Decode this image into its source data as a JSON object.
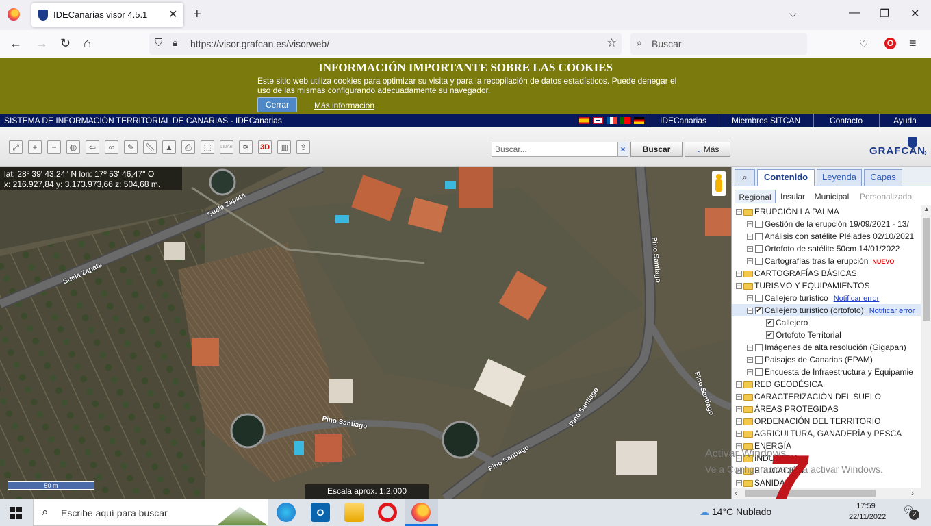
{
  "browser": {
    "tab_title": "IDECanarias visor 4.5.1",
    "url": "https://visor.grafcan.es/visorweb/",
    "search_placeholder": "Buscar"
  },
  "cookie_banner": {
    "title": "INFORMACIÓN IMPORTANTE SOBRE LAS COOKIES",
    "text": "Este sitio web utiliza cookies para optimizar su visita y para la recopilación de datos estadísticos. Puede denegar el uso de las mismas configurando adecuadamente su navegador.",
    "close_label": "Cerrar",
    "more_label": "Más información"
  },
  "site_header": {
    "title": "SISTEMA DE INFORMACIÓN TERRITORIAL DE CANARIAS - IDECanarias",
    "links": [
      "IDECanarias",
      "Miembros SITCAN",
      "Contacto",
      "Ayuda"
    ]
  },
  "toolbar": {
    "search_placeholder": "Buscar...",
    "search_clear": "×",
    "search_button": "Buscar",
    "more_button": "Más",
    "brand": "GRAFCAN",
    "brand_arrow": "»",
    "tools": [
      "full-extent",
      "zoom-in",
      "zoom-out",
      "globe",
      "back",
      "link",
      "draw",
      "measure",
      "profile",
      "print",
      "select",
      "lidar",
      "layers",
      "3D",
      "info",
      "share"
    ]
  },
  "map": {
    "coords_line1": "lat: 28º 39' 43,24'' N  lon: 17º 53' 46,47'' O",
    "coords_line2": "x: 216.927,84  y: 3.173.973,66  z: 504,68 m.",
    "scale_bar_label": "50 m",
    "scale_text": "Escala aprox. 1:2.000",
    "road_labels": [
      "Suela Zapata",
      "Suela Zapata",
      "Pino Santiago",
      "Pino Santiago",
      "Pino Santiago",
      "Pino Santiago",
      "Pino Santiago"
    ]
  },
  "panel": {
    "tabs": [
      "Contenido",
      "Leyenda",
      "Capas"
    ],
    "subtabs": [
      "Regional",
      "Insular",
      "Municipal",
      "Personalizado"
    ],
    "tree": [
      {
        "label": "ERUPCIÓN LA PALMA",
        "type": "folder",
        "level": 0,
        "exp": "−"
      },
      {
        "label": "Gestión de la erupción 19/09/2021 - 13/",
        "type": "layer",
        "level": 1,
        "exp": "+",
        "checked": false
      },
      {
        "label": "Análisis con satélite Pléiades 02/10/2021",
        "type": "layer",
        "level": 1,
        "exp": "+",
        "checked": false
      },
      {
        "label": "Ortofoto de satélite 50cm 14/01/2022",
        "type": "layer",
        "level": 1,
        "exp": "+",
        "checked": false
      },
      {
        "label": "Cartografías tras la erupción",
        "type": "layer",
        "level": 1,
        "exp": "+",
        "checked": false,
        "badge": "NUEVO"
      },
      {
        "label": "CARTOGRAFÍAS BÁSICAS",
        "type": "folder",
        "level": 0,
        "exp": "+"
      },
      {
        "label": "TURISMO Y EQUIPAMIENTOS",
        "type": "folder",
        "level": 0,
        "exp": "−"
      },
      {
        "label": "Callejero turístico",
        "type": "layer",
        "level": 1,
        "exp": "+",
        "checked": false,
        "link": "Notificar error"
      },
      {
        "label": "Callejero turístico (ortofoto)",
        "type": "layer",
        "level": 1,
        "exp": "−",
        "checked": true,
        "link": "Notificar error",
        "selected": true
      },
      {
        "label": "Callejero",
        "type": "layer",
        "level": 2,
        "checked": true
      },
      {
        "label": "Ortofoto Territorial",
        "type": "layer",
        "level": 2,
        "checked": true
      },
      {
        "label": "Imágenes de alta resolución (Gigapan)",
        "type": "layer",
        "level": 1,
        "exp": "+",
        "checked": false
      },
      {
        "label": "Paisajes de Canarias (EPAM)",
        "type": "layer",
        "level": 1,
        "exp": "+",
        "checked": false
      },
      {
        "label": "Encuesta de Infraestructura y Equipamie",
        "type": "layer",
        "level": 1,
        "exp": "+",
        "checked": false
      },
      {
        "label": "RED GEODÉSICA",
        "type": "folder",
        "level": 0,
        "exp": "+"
      },
      {
        "label": "CARACTERIZACIÓN DEL SUELO",
        "type": "folder",
        "level": 0,
        "exp": "+"
      },
      {
        "label": "ÁREAS PROTEGIDAS",
        "type": "folder",
        "level": 0,
        "exp": "+"
      },
      {
        "label": "ORDENACIÓN DEL TERRITORIO",
        "type": "folder",
        "level": 0,
        "exp": "+"
      },
      {
        "label": "AGRICULTURA, GANADERÍA y PESCA",
        "type": "folder",
        "level": 0,
        "exp": "+"
      },
      {
        "label": "ENERGÍA",
        "type": "folder",
        "level": 0,
        "exp": "+"
      },
      {
        "label": "INDUSTRIA",
        "type": "folder",
        "level": 0,
        "exp": "+"
      },
      {
        "label": "EDUCACIÓN",
        "type": "folder",
        "level": 0,
        "exp": "+"
      },
      {
        "label": "SANIDAD",
        "type": "folder",
        "level": 0,
        "exp": "+"
      }
    ]
  },
  "os_overlay": {
    "activate_title": "Activar Windows",
    "activate_text": "Ve a Configuración para activar Windows."
  },
  "taskbar": {
    "search_placeholder": "Escribe aquí para buscar",
    "weather": "14°C  Nublado",
    "time": "17:59",
    "date": "22/11/2022",
    "notifications": "2"
  },
  "watermark": "7"
}
